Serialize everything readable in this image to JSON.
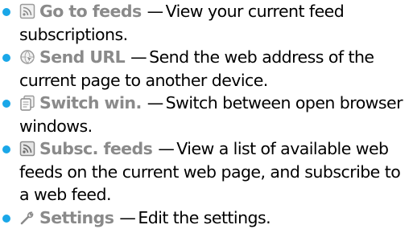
{
  "items": [
    {
      "icon": "feeds-icon",
      "label": "Go to feeds",
      "dash": "—",
      "desc": "View your current feed subscriptions."
    },
    {
      "icon": "send-url-icon",
      "label": "Send URL",
      "dash": "—",
      "desc": "Send the web address of the current page to another device."
    },
    {
      "icon": "switch-window-icon",
      "label": "Switch win.",
      "dash": "—",
      "desc": "Switch between open browser windows."
    },
    {
      "icon": "subscribe-feeds-icon",
      "label": "Subsc. feeds",
      "dash": "—",
      "desc": "View a list of available web feeds on the current web page, and subscribe to a web feed."
    },
    {
      "icon": "settings-icon",
      "label": "Settings",
      "dash": "—",
      "desc": "Edit the settings."
    }
  ],
  "colors": {
    "bullet": "#1aa7e8",
    "label": "#8a8a8a"
  }
}
